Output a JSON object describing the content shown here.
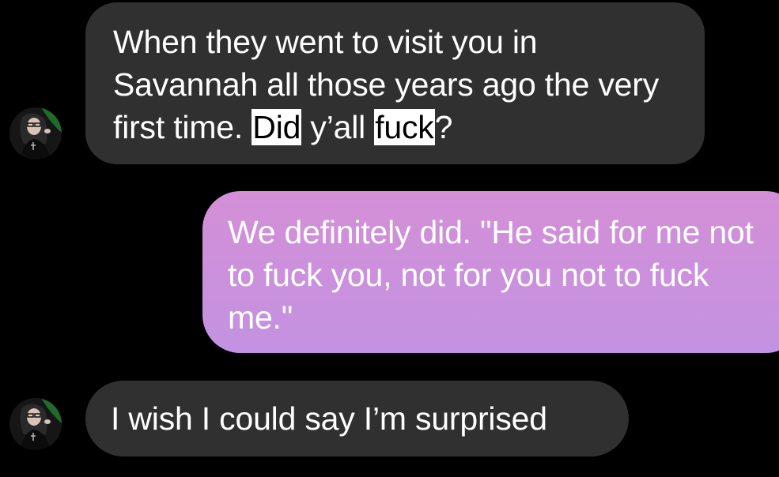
{
  "conversation": {
    "messages": [
      {
        "sender": "contact",
        "segments": [
          {
            "text": "When they went to visit you in Savannah all those years ago the very first time. ",
            "highlight": false
          },
          {
            "text": "Did",
            "highlight": true
          },
          {
            "text": " y’all ",
            "highlight": false
          },
          {
            "text": "fuck",
            "highlight": true
          },
          {
            "text": "?",
            "highlight": false
          }
        ]
      },
      {
        "sender": "me",
        "text": "We definitely did. \"He said for me not to fuck you, not for you not to fuck me.\""
      },
      {
        "sender": "contact",
        "text": "I wish I could say I’m surprised"
      }
    ]
  },
  "theme": {
    "background": "#000000",
    "incoming_bubble": "#303030",
    "outgoing_gradient_top": "#d48fd6",
    "outgoing_gradient_bottom": "#c392e2",
    "text": "#ffffff",
    "highlight_background": "#ffffff",
    "highlight_text": "#000000"
  },
  "icons": {
    "contact_avatar": "contact-avatar-photo"
  }
}
